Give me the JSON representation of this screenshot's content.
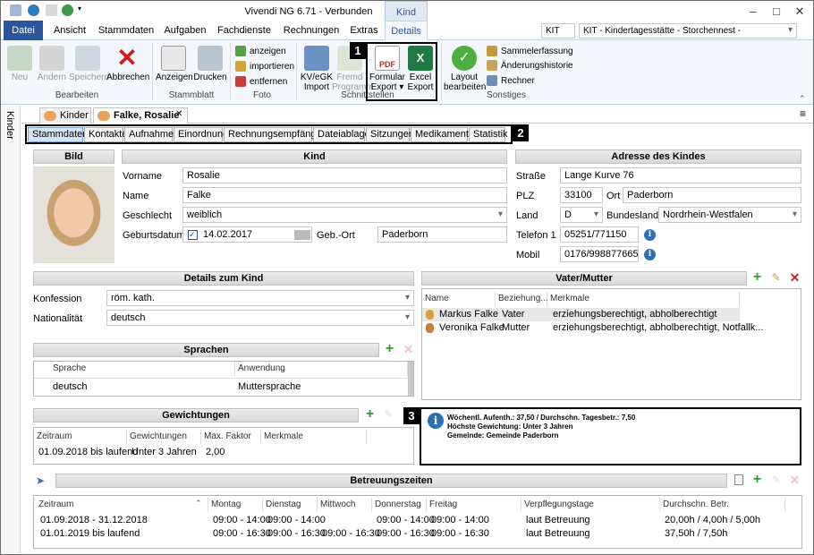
{
  "window": {
    "title": "Vivendi NG 6.71 - Verbunden",
    "context_tab": "Kind",
    "minimize": "–",
    "restore": "□",
    "close": "✕"
  },
  "ribbon_tabs": [
    "Datei",
    "Ansicht",
    "Stammdaten",
    "Aufgaben",
    "Fachdienste",
    "Rechnungen",
    "Extras",
    "Details"
  ],
  "org": {
    "short": "KIT",
    "name": "KIT - Kindertagesstätte - Storchennest -"
  },
  "ribbon": {
    "bearbeiten": {
      "label": "Bearbeiten",
      "neu": "Neu",
      "aendern": "Ändern",
      "speichern": "Speichern",
      "abbrechen": "Abbrechen"
    },
    "stammblatt": {
      "label": "Stammblatt",
      "anzeigen": "Anzeigen",
      "drucken": "Drucken"
    },
    "foto": {
      "label": "Foto",
      "anzeigen": "anzeigen",
      "importieren": "importieren",
      "entfernen": "entfernen"
    },
    "schnittstellen": {
      "label": "Schnittstellen",
      "kv_line1": "KV/eGK",
      "kv_line2": "Import",
      "fremd_line1": "Fremd",
      "fremd_line2": "Programm",
      "formular_line1": "Formular",
      "formular_line2": "Export ▾",
      "excel_line1": "Excel",
      "excel_line2": "Export"
    },
    "sonstiges": {
      "label": "Sonstiges",
      "layout_line1": "Layout",
      "layout_line2": "bearbeiten",
      "sammel": "Sammelerfassung",
      "historie": "Änderungshistorie",
      "rechner": "Rechner"
    }
  },
  "side_label": "Kinder",
  "doc_tabs": {
    "kinder": "Kinder",
    "person": "Falke, Rosalie",
    "close": "✕"
  },
  "sub_tabs": [
    "Stammdaten",
    "Kontakte",
    "Aufnahme",
    "Einordnung",
    "Rechnungsempfänger",
    "Dateiablage",
    "Sitzungen",
    "Medikamente",
    "Statistik"
  ],
  "callouts": [
    "1",
    "2",
    "3"
  ],
  "bild": {
    "header": "Bild"
  },
  "kind": {
    "header": "Kind",
    "vorname_label": "Vorname",
    "vorname": "Rosalie",
    "name_label": "Name",
    "name": "Falke",
    "geschlecht_label": "Geschlecht",
    "geschlecht": "weiblich",
    "geburtsdatum_label": "Geburtsdatum",
    "geburtsdatum": "14.02.2017",
    "gebort_label": "Geb.-Ort",
    "gebort": "Paderborn"
  },
  "adresse": {
    "header": "Adresse des Kindes",
    "strasse_label": "Straße",
    "strasse": "Lange Kurve 76",
    "plz_label": "PLZ",
    "plz": "33100",
    "ort_label": "Ort",
    "ort": "Paderborn",
    "land_label": "Land",
    "land": "D",
    "bundesland_label": "Bundesland",
    "bundesland": "Nordrhein-Westfalen",
    "telefon_label": "Telefon 1",
    "telefon": "05251/771150",
    "mobil_label": "Mobil",
    "mobil": "0176/998877665"
  },
  "details": {
    "header": "Details zum Kind",
    "konfession_label": "Konfession",
    "konfession": "röm. kath.",
    "nationalitaet_label": "Nationalität",
    "nationalitaet": "deutsch"
  },
  "eltern": {
    "header": "Vater/Mutter",
    "columns": [
      "Name",
      "Beziehung...",
      "Merkmale"
    ],
    "rows": [
      {
        "name": "Markus Falke",
        "beziehung": "Vater",
        "merkmale": "erziehungsberechtigt, abholberechtigt"
      },
      {
        "name": "Veronika Falke",
        "beziehung": "Mutter",
        "merkmale": "erziehungsberechtigt, abholberechtigt, Notfallk..."
      }
    ]
  },
  "sprachen": {
    "header": "Sprachen",
    "columns": [
      "Sprache",
      "Anwendung"
    ],
    "rows": [
      {
        "sprache": "deutsch",
        "anwendung": "Muttersprache"
      }
    ]
  },
  "info": {
    "line1": "Wöchentl. Aufenth.: 37,50 / Durchschn. Tagesbetr.: 7,50",
    "line2": "Höchste Gewichtung: Unter 3 Jahren",
    "line3": "Gemeinde: Gemeinde Paderborn"
  },
  "gewichtungen": {
    "header": "Gewichtungen",
    "columns": [
      "Zeitraum",
      "Gewichtungen",
      "Max. Faktor",
      "Merkmale"
    ],
    "rows": [
      {
        "zeitraum": "01.09.2018 bis laufend",
        "gewichtung": "Unter 3 Jahren",
        "faktor": "2,00",
        "merkmale": ""
      }
    ]
  },
  "betreuung": {
    "header": "Betreuungszeiten",
    "columns": [
      "Zeitraum",
      "Montag",
      "Dienstag",
      "Mittwoch",
      "Donnerstag",
      "Freitag",
      "Verpflegungstage",
      "Durchschn. Betr."
    ],
    "rows": [
      [
        "01.09.2018 - 31.12.2018",
        "09:00 - 14:00",
        "09:00 - 14:00",
        "",
        "09:00 - 14:00",
        "09:00 - 14:00",
        "laut Betreuung",
        "20,00h / 4,00h / 5,00h"
      ],
      [
        "01.01.2019 bis laufend",
        "09:00 - 16:30",
        "09:00 - 16:30",
        "09:00 - 16:30",
        "09:00 - 16:30",
        "09:00 - 16:30",
        "laut Betreuung",
        "37,50h / 7,50h"
      ]
    ]
  }
}
